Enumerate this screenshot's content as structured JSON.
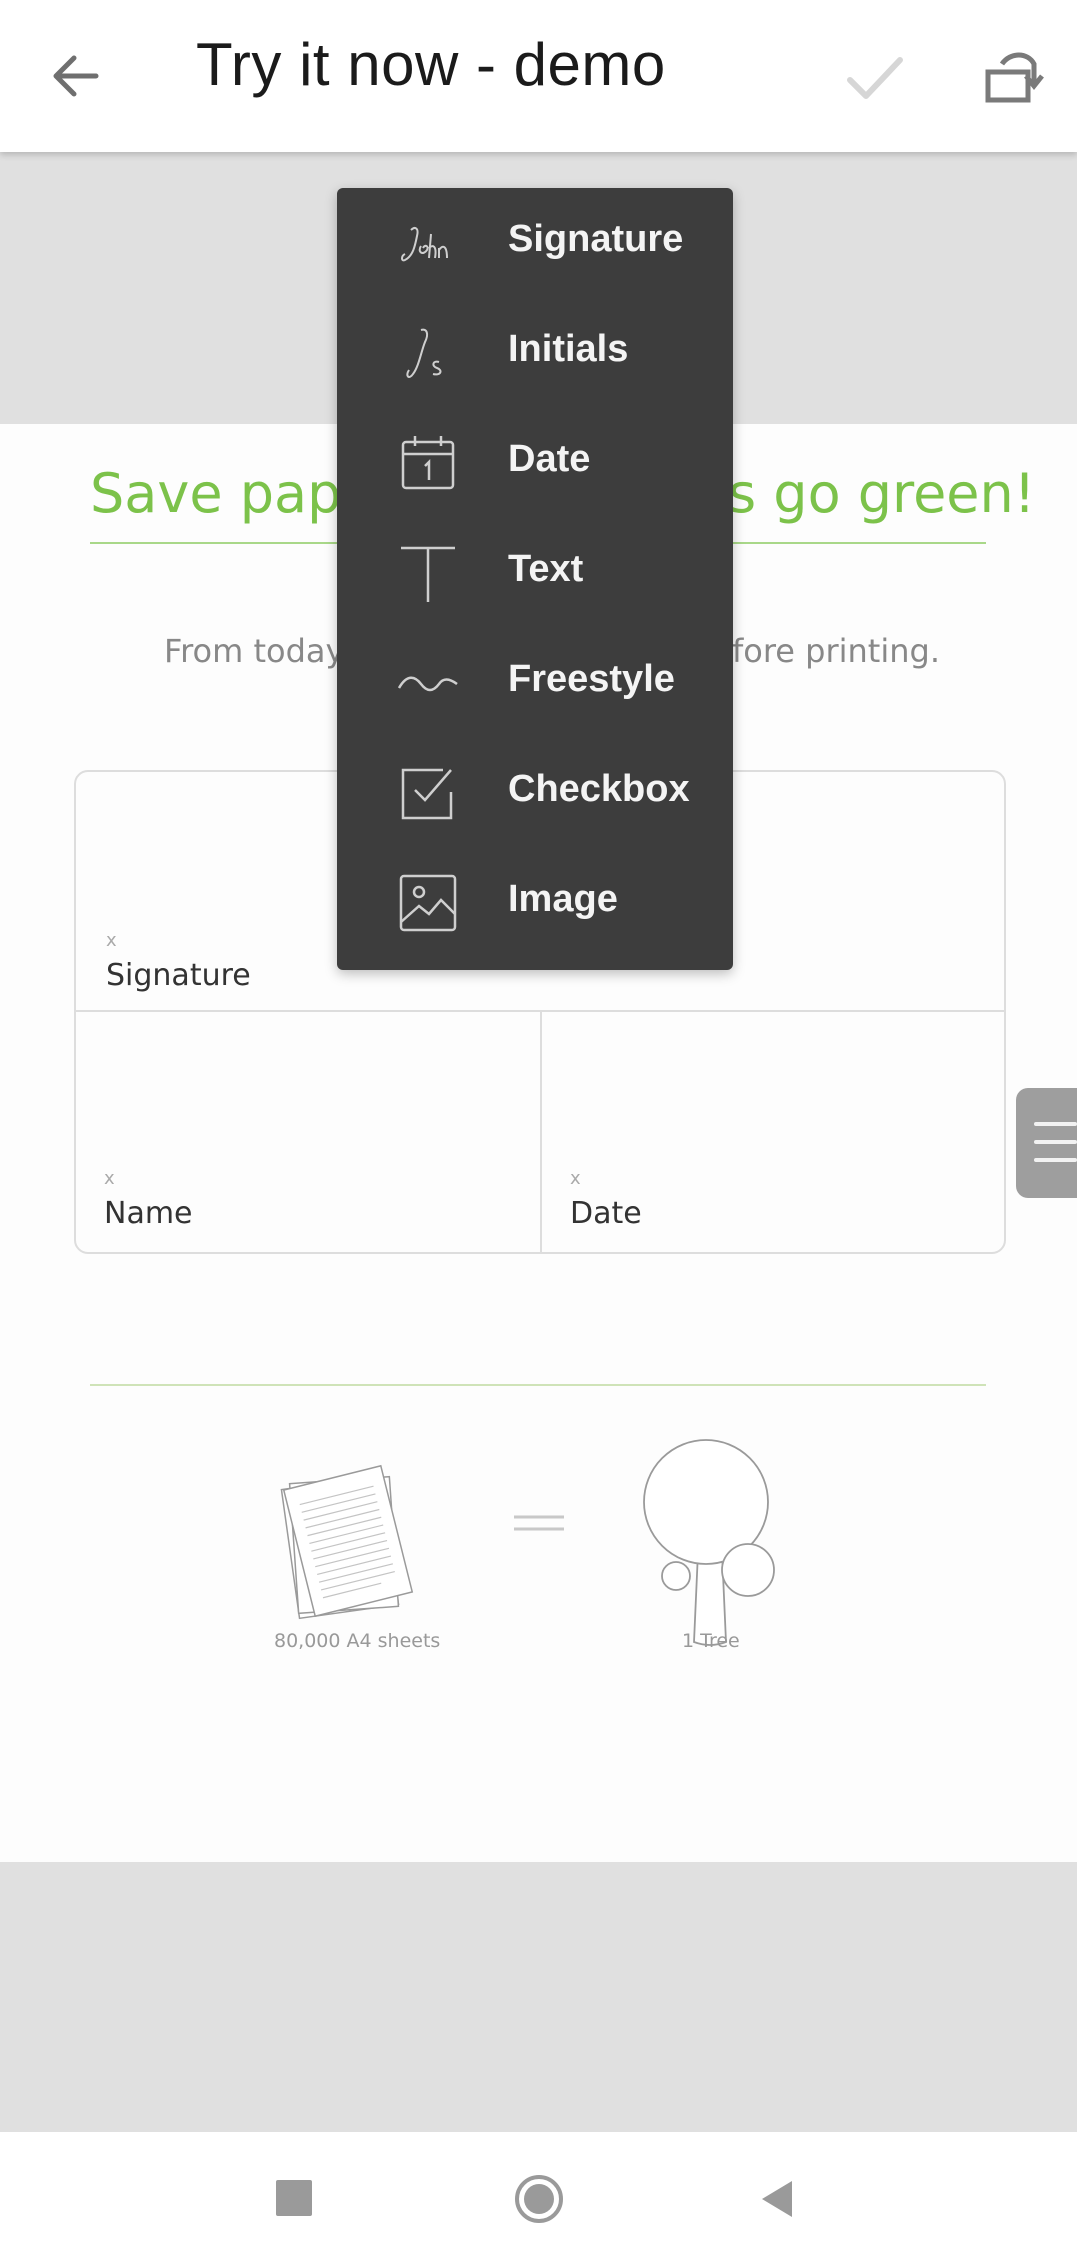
{
  "app_bar": {
    "title": "Try it now - demo"
  },
  "document": {
    "heading_left": "Save pape",
    "heading_right": "s go green!",
    "subtext_left": "From today",
    "subtext_right": "fore printing.",
    "fields": {
      "signature": {
        "x": "x",
        "label": "Signature"
      },
      "name": {
        "x": "x",
        "label": "Name"
      },
      "date": {
        "x": "x",
        "label": "Date"
      }
    },
    "illustration": {
      "left_caption": "80,000 A4 sheets",
      "right_caption": "1 Tree"
    }
  },
  "menu": {
    "items": [
      {
        "label": "Signature",
        "icon": "signature-script-icon"
      },
      {
        "label": "Initials",
        "icon": "initials-script-icon"
      },
      {
        "label": "Date",
        "icon": "calendar-icon"
      },
      {
        "label": "Text",
        "icon": "text-t-icon"
      },
      {
        "label": "Freestyle",
        "icon": "freestyle-wave-icon"
      },
      {
        "label": "Checkbox",
        "icon": "checkbox-icon"
      },
      {
        "label": "Image",
        "icon": "image-icon"
      }
    ]
  },
  "colors": {
    "accent_green": "#7cc24a",
    "menu_background": "#3d3d3d",
    "page_background": "#e0e0e0"
  }
}
